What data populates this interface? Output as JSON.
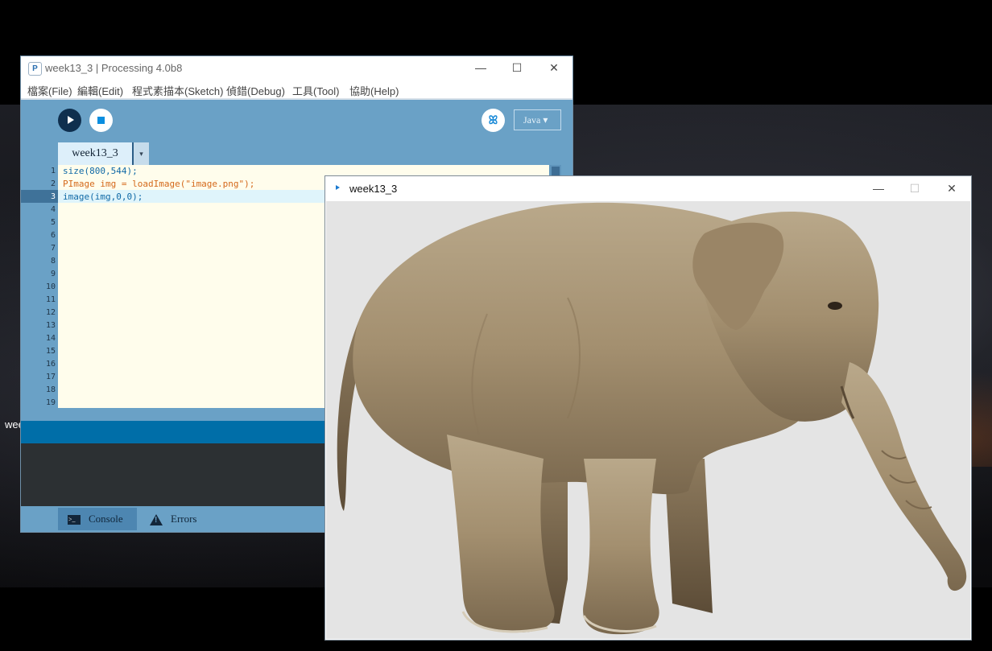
{
  "desktop": {
    "partial_text": "wee"
  },
  "ide": {
    "title": "week13_3 | Processing 4.0b8",
    "app_icon": "processing-logo-icon",
    "window_controls": {
      "minimize": "—",
      "maximize": "☐",
      "close": "✕"
    },
    "menu": [
      "檔案(File)",
      "編輯(Edit)",
      "程式素描本(Sketch)",
      "偵錯(Debug)",
      "工具(Tool)",
      "協助(Help)"
    ],
    "toolbar": {
      "run_icon": "play-icon",
      "stop_icon": "stop-icon",
      "debug_icon": "butterfly-debug-icon",
      "debug_glyph": "ꕤ",
      "mode": "Java ▾"
    },
    "tab": {
      "label": "week13_3",
      "menu_arrow": "▾"
    },
    "editor": {
      "line_numbers": [
        "1",
        "2",
        "3",
        "4",
        "5",
        "6",
        "7",
        "8",
        "9",
        "10",
        "11",
        "12",
        "13",
        "14",
        "15",
        "16",
        "17",
        "18",
        "19"
      ],
      "current_line": 3,
      "code": [
        "size(800,544);",
        "PImage img = loadImage(\"image.png\");",
        "image(img,0,0);"
      ]
    },
    "console_tabs": [
      {
        "label": "Console",
        "icon": "console-icon",
        "active": true
      },
      {
        "label": "Errors",
        "icon": "warning-icon",
        "active": false
      }
    ],
    "colors": {
      "toolbar": "#6aa1c6",
      "status_bar": "#006ea8",
      "console_bg": "#2c3033",
      "editor_bg": "#fffdec"
    }
  },
  "sketch_window": {
    "title": "week13_3",
    "window_controls": {
      "minimize": "—",
      "maximize": "☐",
      "close": "✕"
    },
    "canvas_background": "#e4e4e4",
    "image_subject": "elephant"
  }
}
